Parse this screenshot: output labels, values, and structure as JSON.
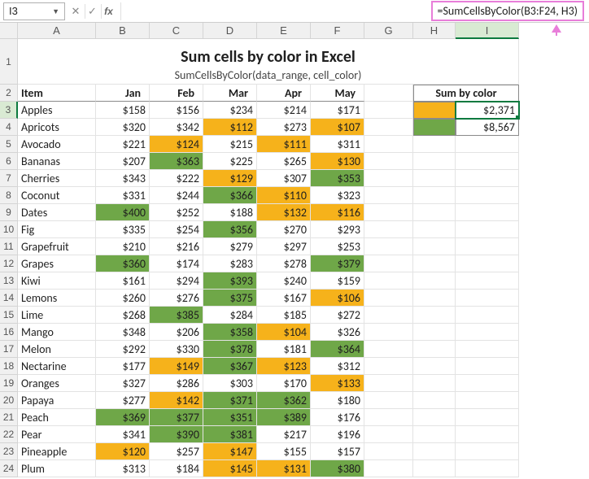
{
  "namebox": "I3",
  "formula": "=SumCellsByColor(B3:F24, H3)",
  "title": "Sum cells by color in Excel",
  "subtitle": "SumCellsByColor(data_range, cell_color)",
  "columns": [
    "A",
    "B",
    "C",
    "D",
    "E",
    "F",
    "G",
    "H",
    "I"
  ],
  "headers": {
    "item": "Item",
    "jan": "Jan",
    "feb": "Feb",
    "mar": "Mar",
    "apr": "Apr",
    "may": "May",
    "sumby": "Sum by color"
  },
  "sum": {
    "yellow": "$2,371",
    "green": "$8,567"
  },
  "colors": {
    "yellow": "#f6b21b",
    "green": "#6fa748"
  },
  "rows": [
    {
      "n": 3,
      "item": "Apples",
      "v": [
        "$158",
        "$156",
        "$234",
        "$214",
        "$171"
      ],
      "c": [
        "",
        "",
        "",
        "",
        ""
      ]
    },
    {
      "n": 4,
      "item": "Apricots",
      "v": [
        "$320",
        "$342",
        "$112",
        "$273",
        "$107"
      ],
      "c": [
        "",
        "",
        "y",
        "",
        "y"
      ]
    },
    {
      "n": 5,
      "item": "Avocado",
      "v": [
        "$221",
        "$124",
        "$215",
        "$111",
        "$311"
      ],
      "c": [
        "",
        "y",
        "",
        "y",
        ""
      ]
    },
    {
      "n": 6,
      "item": "Bananas",
      "v": [
        "$207",
        "$363",
        "$225",
        "$265",
        "$130"
      ],
      "c": [
        "",
        "g",
        "",
        "",
        "y"
      ]
    },
    {
      "n": 7,
      "item": "Cherries",
      "v": [
        "$343",
        "$222",
        "$129",
        "$307",
        "$353"
      ],
      "c": [
        "",
        "",
        "y",
        "",
        "g"
      ]
    },
    {
      "n": 8,
      "item": "Coconut",
      "v": [
        "$331",
        "$244",
        "$366",
        "$110",
        "$323"
      ],
      "c": [
        "",
        "",
        "g",
        "y",
        ""
      ]
    },
    {
      "n": 9,
      "item": "Dates",
      "v": [
        "$400",
        "$252",
        "$188",
        "$132",
        "$116"
      ],
      "c": [
        "g",
        "",
        "",
        "y",
        "y"
      ]
    },
    {
      "n": 10,
      "item": "Fig",
      "v": [
        "$335",
        "$254",
        "$356",
        "$270",
        "$293"
      ],
      "c": [
        "",
        "",
        "g",
        "",
        ""
      ]
    },
    {
      "n": 11,
      "item": "Grapefruit",
      "v": [
        "$210",
        "$216",
        "$279",
        "$297",
        "$253"
      ],
      "c": [
        "",
        "",
        "",
        "",
        ""
      ]
    },
    {
      "n": 12,
      "item": "Grapes",
      "v": [
        "$360",
        "$174",
        "$283",
        "$278",
        "$379"
      ],
      "c": [
        "g",
        "",
        "",
        "",
        "g"
      ]
    },
    {
      "n": 13,
      "item": "Kiwi",
      "v": [
        "$161",
        "$294",
        "$393",
        "$240",
        "$159"
      ],
      "c": [
        "",
        "",
        "g",
        "",
        ""
      ]
    },
    {
      "n": 14,
      "item": "Lemons",
      "v": [
        "$260",
        "$276",
        "$375",
        "$167",
        "$106"
      ],
      "c": [
        "",
        "",
        "g",
        "",
        "y"
      ]
    },
    {
      "n": 15,
      "item": "Lime",
      "v": [
        "$268",
        "$385",
        "$284",
        "$185",
        "$272"
      ],
      "c": [
        "",
        "g",
        "",
        "",
        ""
      ]
    },
    {
      "n": 16,
      "item": "Mango",
      "v": [
        "$348",
        "$206",
        "$358",
        "$104",
        "$326"
      ],
      "c": [
        "",
        "",
        "g",
        "y",
        ""
      ]
    },
    {
      "n": 17,
      "item": "Melon",
      "v": [
        "$292",
        "$330",
        "$378",
        "$181",
        "$364"
      ],
      "c": [
        "",
        "",
        "g",
        "",
        "g"
      ]
    },
    {
      "n": 18,
      "item": "Nectarine",
      "v": [
        "$177",
        "$149",
        "$367",
        "$123",
        "$312"
      ],
      "c": [
        "",
        "y",
        "g",
        "y",
        ""
      ]
    },
    {
      "n": 19,
      "item": "Oranges",
      "v": [
        "$327",
        "$286",
        "$303",
        "$170",
        "$133"
      ],
      "c": [
        "",
        "",
        "",
        "",
        "y"
      ]
    },
    {
      "n": 20,
      "item": "Papaya",
      "v": [
        "$277",
        "$142",
        "$371",
        "$362",
        "$180"
      ],
      "c": [
        "",
        "y",
        "g",
        "g",
        ""
      ]
    },
    {
      "n": 21,
      "item": "Peach",
      "v": [
        "$369",
        "$377",
        "$351",
        "$389",
        "$176"
      ],
      "c": [
        "g",
        "g",
        "g",
        "g",
        ""
      ]
    },
    {
      "n": 22,
      "item": "Pear",
      "v": [
        "$341",
        "$390",
        "$381",
        "$217",
        "$196"
      ],
      "c": [
        "",
        "g",
        "g",
        "",
        ""
      ]
    },
    {
      "n": 23,
      "item": "Pineapple",
      "v": [
        "$120",
        "$257",
        "$147",
        "$155",
        "$157"
      ],
      "c": [
        "y",
        "",
        "y",
        "",
        ""
      ]
    },
    {
      "n": 24,
      "item": "Plum",
      "v": [
        "$313",
        "$184",
        "$145",
        "$131",
        "$380"
      ],
      "c": [
        "",
        "",
        "y",
        "y",
        "g"
      ]
    }
  ]
}
